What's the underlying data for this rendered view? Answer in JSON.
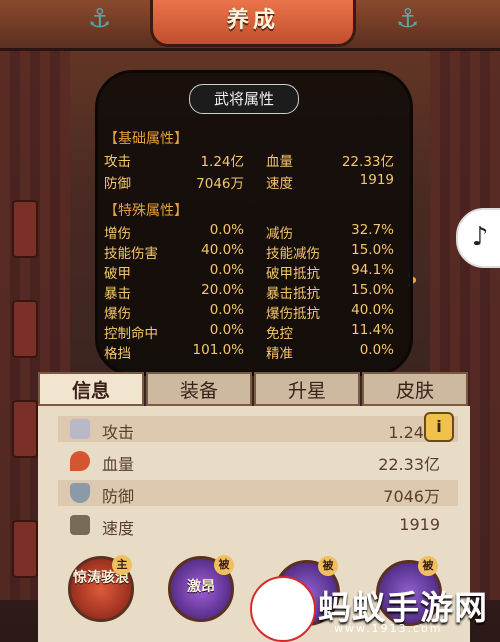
{
  "header": {
    "title": "养成"
  },
  "popup": {
    "title": "武将属性",
    "basic_section": "【基础属性】",
    "special_section": "【特殊属性】",
    "basic": [
      [
        "攻击",
        "1.24亿",
        "血量",
        "22.33亿"
      ],
      [
        "防御",
        "7046万",
        "速度",
        "1919"
      ]
    ],
    "special": [
      [
        "增伤",
        "0.0%",
        "减伤",
        "32.7%"
      ],
      [
        "技能伤害",
        "40.0%",
        "技能减伤",
        "15.0%"
      ],
      [
        "破甲",
        "0.0%",
        "破甲抵抗",
        "94.1%"
      ],
      [
        "暴击",
        "20.0%",
        "暴击抵抗",
        "15.0%"
      ],
      [
        "爆伤",
        "0.0%",
        "爆伤抵抗",
        "40.0%"
      ],
      [
        "控制命中",
        "0.0%",
        "免控",
        "11.4%"
      ],
      [
        "格挡",
        "101.0%",
        "精准",
        "0.0%"
      ]
    ]
  },
  "tabs": [
    "信息",
    "装备",
    "升星",
    "皮肤"
  ],
  "active_tab": "信息",
  "info_button": "i",
  "stats": [
    {
      "label": "攻击",
      "value": "1.24亿",
      "icon": "sword-icon"
    },
    {
      "label": "血量",
      "value": "22.33亿",
      "icon": "blood-drop-icon"
    },
    {
      "label": "防御",
      "value": "7046万",
      "icon": "shield-icon"
    },
    {
      "label": "速度",
      "value": "1919",
      "icon": "boot-icon"
    }
  ],
  "skills": [
    {
      "label": "惊涛骇浪",
      "badge": "主"
    },
    {
      "label": "激昂",
      "badge": "被"
    },
    {
      "label": "",
      "badge": "被"
    },
    {
      "label": "",
      "badge": "被"
    }
  ],
  "watermark": {
    "name": "蚂蚁手游网",
    "url": "www.1913.com"
  }
}
